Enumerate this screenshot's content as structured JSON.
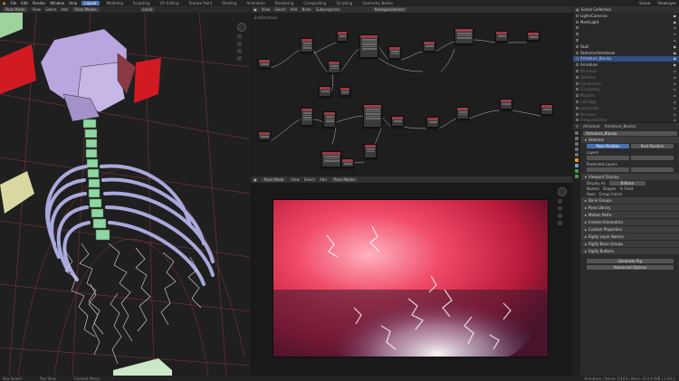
{
  "topbar": {
    "menus": [
      "File",
      "Edit",
      "Render",
      "Window",
      "Help"
    ],
    "workspaces": [
      {
        "label": "Layout",
        "active": true
      },
      {
        "label": "Modeling",
        "active": false
      },
      {
        "label": "Sculpting",
        "active": false
      },
      {
        "label": "UV Editing",
        "active": false
      },
      {
        "label": "Texture Paint",
        "active": false
      },
      {
        "label": "Shading",
        "active": false
      },
      {
        "label": "Animation",
        "active": false
      },
      {
        "label": "Rendering",
        "active": false
      },
      {
        "label": "Compositing",
        "active": false
      },
      {
        "label": "Scripting",
        "active": false
      },
      {
        "label": "Geometry Nodes",
        "active": false
      }
    ],
    "scene": "Scene",
    "view_layer": "ViewLayer"
  },
  "viewport3d": {
    "menus": [
      "View",
      "Select",
      "Add",
      "Pose Modes"
    ],
    "mode": "Pose Mode",
    "shading": "Local"
  },
  "node_editor": {
    "header_menus": [
      "View",
      "Select",
      "Add",
      "Node",
      "Subprograms"
    ],
    "node_tree": "Nodegoal/sketch",
    "breadcrumb": "ExtStructure"
  },
  "image_editor": {
    "mode": "Pose Mode",
    "menus": [
      "View",
      "Select",
      "Add",
      "Pose Modes"
    ]
  },
  "outliner": {
    "header": "Scene Collection",
    "items": [
      {
        "label": "LightsCameras",
        "dim": false,
        "sel": false
      },
      {
        "label": "MeshLight",
        "dim": false,
        "sel": false
      },
      {
        "label": "",
        "dim": true,
        "sel": false
      },
      {
        "label": "",
        "dim": true,
        "sel": false
      },
      {
        "label": "",
        "dim": true,
        "sel": false
      },
      {
        "label": "Skull",
        "dim": false,
        "sel": false
      },
      {
        "label": "Skeleton/Vertebrae",
        "dim": false,
        "sel": false
      },
      {
        "label": "Armature_Blanka",
        "dim": false,
        "sel": true
      },
      {
        "label": "Armature",
        "dim": false,
        "sel": false
      },
      {
        "label": "Structure",
        "dim": true,
        "sel": false
      },
      {
        "label": "Skeleton",
        "dim": true,
        "sel": false
      },
      {
        "label": "Connectors",
        "dim": true,
        "sel": false
      },
      {
        "label": "Circulatory",
        "dim": true,
        "sel": false
      },
      {
        "label": "Muscles",
        "dim": true,
        "sel": false
      },
      {
        "label": "Cartilage",
        "dim": true,
        "sel": false
      },
      {
        "label": "Lymphatic",
        "dim": true,
        "sel": false
      },
      {
        "label": "Nervous",
        "dim": true,
        "sel": false
      },
      {
        "label": "Integumentary",
        "dim": true,
        "sel": false
      }
    ]
  },
  "properties": {
    "header_left": "Armature",
    "header_right": "Armature_Blanka",
    "object_name": "Armature_Blanka",
    "skeleton": {
      "title": "Skeleton",
      "pose_position": "Pose Position",
      "rest_position": "Rest Position",
      "layers_label": "Layers",
      "protected_label": "Protected Layers"
    },
    "viewport_display": {
      "title": "Viewport Display",
      "display_as_label": "Display As",
      "display_as": "B-Bone",
      "names": "Names",
      "shapes": "Shapes",
      "in_front": "In Front",
      "axes": "Axes",
      "group_colors": "Group Colors"
    },
    "panels": [
      "Bone Groups",
      "Pose Library",
      "Motion Paths",
      "Inverse Kinematics",
      "Custom Properties",
      "Rigify Layer Names",
      "Rigify Bone Groups",
      "Rigify Buttons"
    ],
    "generate_button": "Generate Rig",
    "advanced_button": "Advanced Options"
  },
  "statusbar": {
    "left": "Box Select",
    "mid": "Pan View",
    "mid2": "Context Menu",
    "stats": "Armature | Bones 1/164 | Mem: 413.9 MiB | 2.83.2"
  }
}
